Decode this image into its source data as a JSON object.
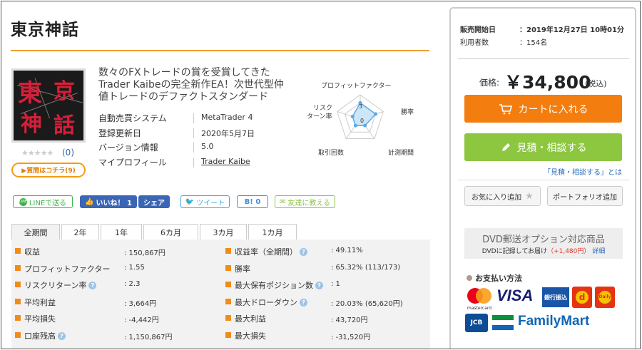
{
  "product": {
    "title": "東京神話",
    "image_kanji": [
      "東",
      "京",
      "神",
      "話"
    ],
    "headline": "数々のFXトレードの賞を受賞してきたTrader Kaibeの完全新作EA！次世代型仲値トレードのデファクトスタンダード",
    "stars": "★★★★★",
    "review_count": "(0)",
    "question_button": "▶質問はコチラ(9)",
    "specs": [
      {
        "label": "自動売買システム",
        "value": "MetaTrader 4"
      },
      {
        "label": "登録更新日",
        "value": "2020年5月7日"
      },
      {
        "label": "バージョン情報",
        "value": "5.0"
      },
      {
        "label": "マイプロフィール",
        "value": "Trader Kaibe"
      }
    ]
  },
  "radar": {
    "labels": [
      "プロフィットファクター",
      "勝率",
      "計測期間",
      "取引回数",
      "リスク",
      "ターン率"
    ],
    "tick_labels": [
      "3",
      "0"
    ],
    "values": [
      2,
      2,
      1,
      1,
      1
    ],
    "colors": {
      "fill": "#cde6f7",
      "stroke": "#5aa9e6"
    }
  },
  "social": {
    "line": "LINEで送る",
    "like": "いいね！ 1",
    "share": "シェア",
    "tweet": "ツイート",
    "hatena": "B! 0",
    "mail": "友達に教える"
  },
  "tabs": [
    "全期間",
    "2年",
    "1年",
    "6カ月",
    "3カ月",
    "1カ月"
  ],
  "stats": {
    "left": [
      {
        "label": "収益",
        "value": ": 150,867円",
        "help": false
      },
      {
        "label": "プロフィットファクター",
        "value": ": 1.55",
        "help": false
      },
      {
        "label": "リスクリターン率",
        "value": ": 2.3",
        "help": true
      },
      {
        "label": "平均利益",
        "value": ": 3,664円",
        "help": false
      },
      {
        "label": "平均損失",
        "value": ": -4,442円",
        "help": false
      },
      {
        "label": "口座残高",
        "value": ": 1,150,867円",
        "help": true
      }
    ],
    "right": [
      {
        "label": "収益率（全期間）",
        "value": ": 49.11%",
        "help": true
      },
      {
        "label": "勝率",
        "value": ": 65.32% (113/173)",
        "help": false
      },
      {
        "label": "最大保有ポジション数",
        "value": ": 1",
        "help": true
      },
      {
        "label": "最大ドローダウン",
        "value": ": 20.03% (65,620円)",
        "help": true
      },
      {
        "label": "最大利益",
        "value": ": 43,720円",
        "help": false
      },
      {
        "label": "最大損失",
        "value": ": -31,520円",
        "help": false
      }
    ]
  },
  "sidebar": {
    "release_label": "販売開始日",
    "release_value": "：2019年12月27日 10時01分",
    "users_label": "利用者数",
    "users_value": "：154名",
    "price_label": "価格:",
    "price": "￥34,800",
    "tax": "(税込)",
    "cart_button": "カートに入れる",
    "quote_button": "見積・相談する",
    "quote_link": "「見積・相談する」とは",
    "fav_button": "お気に入り追加",
    "portfolio_button": "ポートフォリオ追加",
    "dvd_title": "DVD郵送オプション対応商品",
    "dvd_sub": "DVDに記録してお届け",
    "dvd_price": "（+1,480円）",
    "dvd_link": "詳細",
    "payment_label": "お支払い方法",
    "payments": [
      "mastercard",
      "VISA",
      "銀行振込",
      "d",
      "Daily",
      "JCB",
      "FamilyMart"
    ]
  },
  "colors": {
    "accent": "#f08c1a",
    "cart": "#f47d0f",
    "quote": "#8dc63f",
    "link": "#2a6bb8"
  }
}
